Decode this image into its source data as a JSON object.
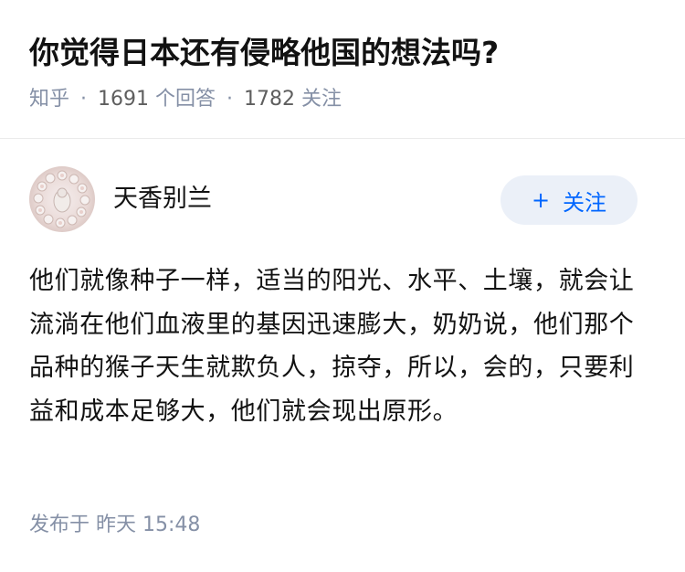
{
  "question": {
    "title": "你觉得日本还有侵略他国的想法吗?",
    "source": "知乎",
    "separator": "·",
    "answers_count": "1691",
    "answers_label": "个回答",
    "followers_count": "1782",
    "followers_label": "关注"
  },
  "answer": {
    "author": {
      "name": "天香别兰",
      "avatar_icon": "avatar-image"
    },
    "follow_button": {
      "icon": "plus-icon",
      "icon_glyph": "+",
      "label": "关注"
    },
    "content": "他们就像种子一样，适当的阳光、水平、土壤，就会让流淌在他们血液里的基因迅速膨大，奶奶说，他们那个品种的猴子天生就欺负人，掠夺，所以，会的，只要利益和成本足够大，他们就会现出原形。",
    "published_label": "发布于",
    "published_time": "昨天 15:48"
  },
  "colors": {
    "text_primary": "#121212",
    "text_secondary": "#8590a6",
    "accent": "#0066ff",
    "follow_button_bg": "#ebf0f8",
    "divider": "#ebebeb"
  }
}
